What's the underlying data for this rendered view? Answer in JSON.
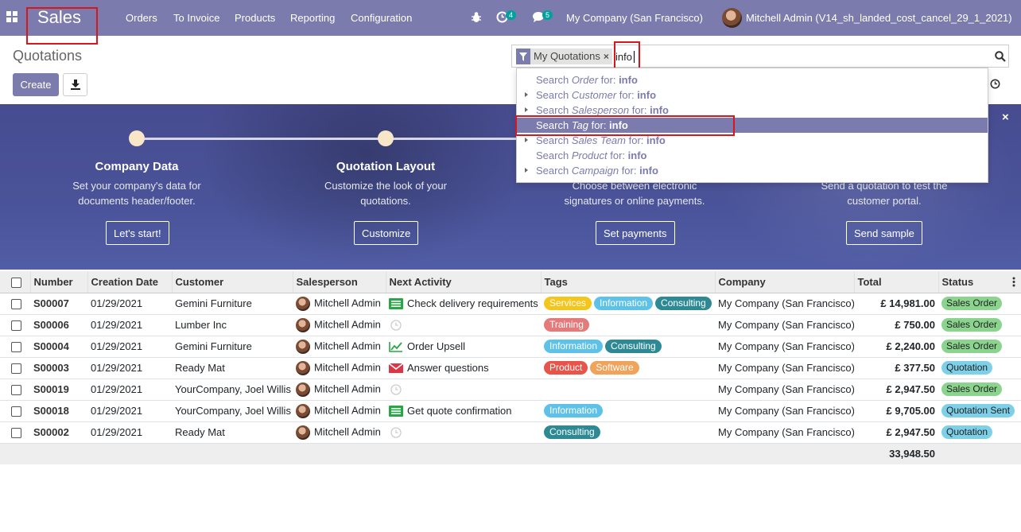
{
  "nav": {
    "brand": "Sales",
    "menu": [
      "Orders",
      "To Invoice",
      "Products",
      "Reporting",
      "Configuration"
    ],
    "activity_count": "4",
    "message_count": "5",
    "company": "My Company (San Francisco)",
    "user": "Mitchell Admin (V14_sh_landed_cost_cancel_29_1_2021)"
  },
  "control": {
    "title": "Quotations",
    "create_label": "Create",
    "facet_label": "My Quotations",
    "facet_remove": "×",
    "search_value": "info"
  },
  "dropdown": {
    "items": [
      {
        "prefix": "Search ",
        "field": "Order",
        "suffix": " for: ",
        "term": "info"
      },
      {
        "prefix": "Search ",
        "field": "Customer",
        "suffix": " for: ",
        "term": "info"
      },
      {
        "prefix": "Search ",
        "field": "Salesperson",
        "suffix": " for: ",
        "term": "info"
      },
      {
        "prefix": "Search ",
        "field": "Tag",
        "suffix": " for: ",
        "term": "info"
      },
      {
        "prefix": "Search ",
        "field": "Sales Team",
        "suffix": " for: ",
        "term": "info"
      },
      {
        "prefix": "Search ",
        "field": "Product",
        "suffix": " for: ",
        "term": "info"
      },
      {
        "prefix": "Search ",
        "field": "Campaign",
        "suffix": " for: ",
        "term": "info"
      }
    ]
  },
  "banner": {
    "close_label": "×",
    "steps": [
      {
        "title": "Company Data",
        "desc1": "Set your company's data for",
        "desc2": "documents header/footer.",
        "button": "Let's start!"
      },
      {
        "title": "Quotation Layout",
        "desc1": "Customize the look of your",
        "desc2": "quotations.",
        "button": "Customize"
      },
      {
        "title": "",
        "desc1": "Choose between electronic",
        "desc2": "signatures or online payments.",
        "button": "Set payments"
      },
      {
        "title": "",
        "desc1": "Send a quotation to test the",
        "desc2": "customer portal.",
        "button": "Send sample"
      }
    ]
  },
  "table": {
    "headers": [
      "Number",
      "Creation Date",
      "Customer",
      "Salesperson",
      "Next Activity",
      "Tags",
      "Company",
      "Total",
      "Status"
    ],
    "rows": [
      {
        "number": "S00007",
        "date": "01/29/2021",
        "customer": "Gemini Furniture",
        "salesperson": "Mitchell Admin",
        "activity": "Check delivery requirements",
        "activity_icon": "todo-icon",
        "tags": [
          "Services",
          "Information",
          "Consulting"
        ],
        "company": "My Company (San Francisco)",
        "total": "£ 14,981.00",
        "status": "Sales Order"
      },
      {
        "number": "S00006",
        "date": "01/29/2021",
        "customer": "Lumber Inc",
        "salesperson": "Mitchell Admin",
        "activity": "",
        "activity_icon": "clock-icon",
        "tags": [
          "Training"
        ],
        "company": "My Company (San Francisco)",
        "total": "£ 750.00",
        "status": "Sales Order"
      },
      {
        "number": "S00004",
        "date": "01/29/2021",
        "customer": "Gemini Furniture",
        "salesperson": "Mitchell Admin",
        "activity": "Order Upsell",
        "activity_icon": "upsell-icon",
        "tags": [
          "Information",
          "Consulting"
        ],
        "company": "My Company (San Francisco)",
        "total": "£ 2,240.00",
        "status": "Sales Order"
      },
      {
        "number": "S00003",
        "date": "01/29/2021",
        "customer": "Ready Mat",
        "salesperson": "Mitchell Admin",
        "activity": "Answer questions",
        "activity_icon": "email-icon",
        "tags": [
          "Product",
          "Software"
        ],
        "company": "My Company (San Francisco)",
        "total": "£ 377.50",
        "status": "Quotation"
      },
      {
        "number": "S00019",
        "date": "01/29/2021",
        "customer": "YourCompany, Joel Willis",
        "salesperson": "Mitchell Admin",
        "activity": "",
        "activity_icon": "clock-icon",
        "tags": [],
        "company": "My Company (San Francisco)",
        "total": "£ 2,947.50",
        "status": "Sales Order"
      },
      {
        "number": "S00018",
        "date": "01/29/2021",
        "customer": "YourCompany, Joel Willis",
        "salesperson": "Mitchell Admin",
        "activity": "Get quote confirmation",
        "activity_icon": "todo-icon",
        "tags": [
          "Information"
        ],
        "company": "My Company (San Francisco)",
        "total": "£ 9,705.00",
        "status": "Quotation Sent"
      },
      {
        "number": "S00002",
        "date": "01/29/2021",
        "customer": "Ready Mat",
        "salesperson": "Mitchell Admin",
        "activity": "",
        "activity_icon": "clock-icon",
        "tags": [
          "Consulting"
        ],
        "company": "My Company (San Francisco)",
        "total": "£ 2,947.50",
        "status": "Quotation"
      }
    ],
    "grand_total": "33,948.50"
  },
  "colors": {
    "primary": "#7c7bad",
    "highlight": "#d7161e",
    "tags": {
      "Services": "#f4c61b",
      "Information": "#5ec1e7",
      "Consulting": "#2d8a94",
      "Training": "#e57a7a",
      "Product": "#e8534a",
      "Software": "#f0a35a"
    },
    "status": {
      "Sales Order": "#8bd48e",
      "Quotation": "#7ed0e8",
      "Quotation Sent": "#7ed0e8"
    }
  }
}
